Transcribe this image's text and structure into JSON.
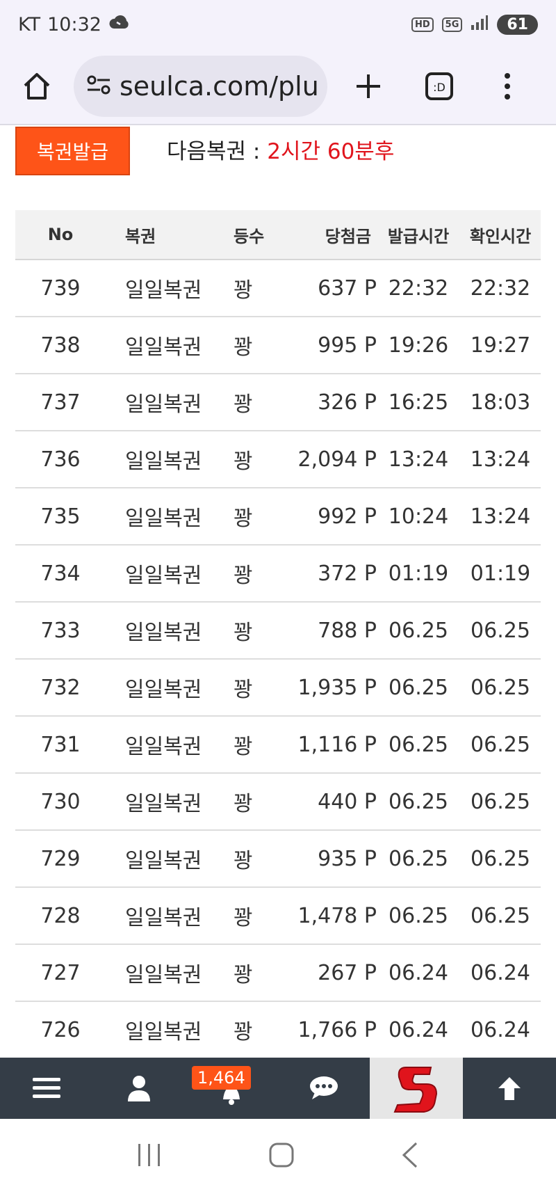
{
  "status_bar": {
    "carrier": "KT",
    "time": "10:32",
    "network_badge_hd": "HD",
    "network_badge_5g": "5G",
    "battery": "61"
  },
  "browser": {
    "url": "seulca.com/plu"
  },
  "issue": {
    "button_label": "복권발급",
    "next_label": "다음복권 : ",
    "next_value": "2시간 60분후"
  },
  "table": {
    "headers": {
      "no": "No",
      "name": "복권",
      "rank": "등수",
      "prize": "당첨금",
      "issued": "발급시간",
      "checked": "확인시간"
    },
    "rows": [
      {
        "no": "739",
        "name": "일일복권",
        "rank": "꽝",
        "prize": "637 P",
        "issued": "22:32",
        "checked": "22:32"
      },
      {
        "no": "738",
        "name": "일일복권",
        "rank": "꽝",
        "prize": "995 P",
        "issued": "19:26",
        "checked": "19:27"
      },
      {
        "no": "737",
        "name": "일일복권",
        "rank": "꽝",
        "prize": "326 P",
        "issued": "16:25",
        "checked": "18:03"
      },
      {
        "no": "736",
        "name": "일일복권",
        "rank": "꽝",
        "prize": "2,094 P",
        "issued": "13:24",
        "checked": "13:24"
      },
      {
        "no": "735",
        "name": "일일복권",
        "rank": "꽝",
        "prize": "992 P",
        "issued": "10:24",
        "checked": "13:24"
      },
      {
        "no": "734",
        "name": "일일복권",
        "rank": "꽝",
        "prize": "372 P",
        "issued": "01:19",
        "checked": "01:19"
      },
      {
        "no": "733",
        "name": "일일복권",
        "rank": "꽝",
        "prize": "788 P",
        "issued": "06.25",
        "checked": "06.25"
      },
      {
        "no": "732",
        "name": "일일복권",
        "rank": "꽝",
        "prize": "1,935 P",
        "issued": "06.25",
        "checked": "06.25"
      },
      {
        "no": "731",
        "name": "일일복권",
        "rank": "꽝",
        "prize": "1,116 P",
        "issued": "06.25",
        "checked": "06.25"
      },
      {
        "no": "730",
        "name": "일일복권",
        "rank": "꽝",
        "prize": "440 P",
        "issued": "06.25",
        "checked": "06.25"
      },
      {
        "no": "729",
        "name": "일일복권",
        "rank": "꽝",
        "prize": "935 P",
        "issued": "06.25",
        "checked": "06.25"
      },
      {
        "no": "728",
        "name": "일일복권",
        "rank": "꽝",
        "prize": "1,478 P",
        "issued": "06.25",
        "checked": "06.25"
      },
      {
        "no": "727",
        "name": "일일복권",
        "rank": "꽝",
        "prize": "267 P",
        "issued": "06.24",
        "checked": "06.24"
      },
      {
        "no": "726",
        "name": "일일복권",
        "rank": "꽝",
        "prize": "1,766 P",
        "issued": "06.24",
        "checked": "06.24"
      }
    ]
  },
  "bottom_nav": {
    "notification_count": "1,464",
    "icons": [
      "menu-icon",
      "user-icon",
      "bell-icon",
      "chat-icon",
      "site-logo",
      "arrow-up-icon"
    ]
  },
  "colors": {
    "accent": "#fe5418",
    "next_value": "#e0141c",
    "nav_bg": "#343d47"
  }
}
